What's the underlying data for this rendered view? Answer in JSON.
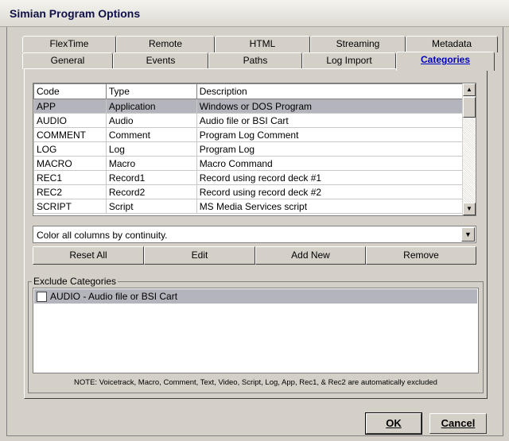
{
  "window": {
    "title": "Simian Program Options"
  },
  "tabs_back": [
    "FlexTime",
    "Remote",
    "HTML",
    "Streaming",
    "Metadata"
  ],
  "tabs_front": [
    "General",
    "Events",
    "Paths",
    "Log Import",
    "Categories"
  ],
  "active_tab": "Categories",
  "grid": {
    "headers": [
      "Code",
      "Type",
      "Description"
    ],
    "rows": [
      [
        "APP",
        "Application",
        "Windows or DOS Program"
      ],
      [
        "AUDIO",
        "Audio",
        "Audio file or BSI Cart"
      ],
      [
        "COMMENT",
        "Comment",
        "Program Log Comment"
      ],
      [
        "LOG",
        "Log",
        "Program Log"
      ],
      [
        "MACRO",
        "Macro",
        "Macro Command"
      ],
      [
        "REC1",
        "Record1",
        "Record using record deck #1"
      ],
      [
        "REC2",
        "Record2",
        "Record using record deck #2"
      ],
      [
        "SCRIPT",
        "Script",
        "MS Media Services script"
      ]
    ],
    "selected_row": 0
  },
  "color_combo": {
    "value": "Color all columns by continuity."
  },
  "buttons": {
    "reset_all": "Reset All",
    "edit": "Edit",
    "add_new": "Add New",
    "remove": "Remove"
  },
  "exclude": {
    "label": "Exclude Categories",
    "items": [
      {
        "text": "AUDIO  -  Audio file or BSI Cart",
        "checked": false
      }
    ]
  },
  "note": "NOTE: Voicetrack, Macro, Comment, Text, Video, Script, Log, App, Rec1, & Rec2 are automatically excluded",
  "dialog": {
    "ok": "OK",
    "cancel": "Cancel"
  }
}
